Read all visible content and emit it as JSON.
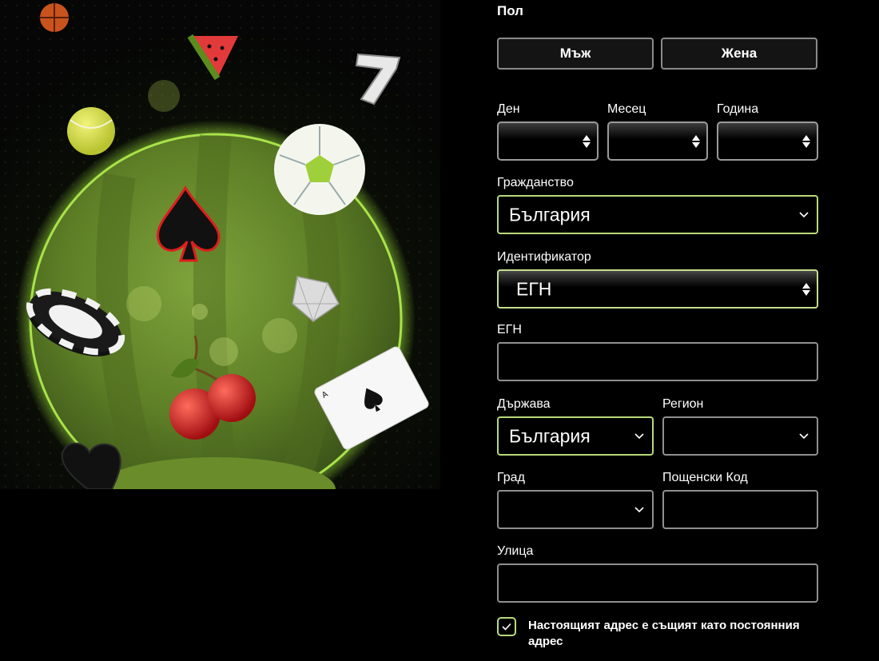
{
  "gender": {
    "label": "Пол",
    "male": "Мъж",
    "female": "Жена"
  },
  "dob": {
    "day_label": "Ден",
    "month_label": "Месец",
    "year_label": "Година"
  },
  "citizenship": {
    "label": "Гражданство",
    "value": "България"
  },
  "identifier": {
    "label": "Идентификатор",
    "value": "ЕГН"
  },
  "egn": {
    "label": "ЕГН",
    "value": ""
  },
  "country": {
    "label": "Държава",
    "value": "България"
  },
  "region": {
    "label": "Регион",
    "value": ""
  },
  "city": {
    "label": "Град",
    "value": ""
  },
  "postal": {
    "label": "Пощенски Код",
    "value": ""
  },
  "street": {
    "label": "Улица",
    "value": ""
  },
  "address_same": {
    "label": "Настоящият адрес е същият като постоянния адрес",
    "checked": true
  },
  "colors": {
    "accent": "#b8d97a",
    "border": "#8f8f8f",
    "background": "#000000"
  }
}
